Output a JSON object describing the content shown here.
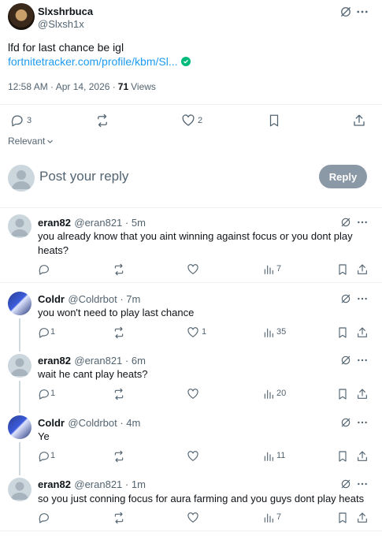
{
  "post": {
    "author_name": "Slxshrbuca",
    "author_handle": "@Slxsh1x",
    "text": "lfd for last chance be igl",
    "link_text": "fortnitetracker.com/profile/kbm/Sl...",
    "timestamp": "12:58 AM · Apr 14, 2026 ·",
    "views_count": "71",
    "views_label": "Views",
    "reply_count": "3",
    "like_count": "2",
    "sort_label": "Relevant"
  },
  "composer": {
    "placeholder": "Post your reply",
    "reply_button": "Reply"
  },
  "replies": [
    {
      "name": "eran82",
      "meta": "@eran821 · 5m",
      "text": "you already know that you aint winning against focus or you dont play heats?",
      "reply_count": "",
      "like_count": "",
      "views": "7"
    },
    {
      "name": "Coldr",
      "meta": "@Coldrbot · 7m",
      "text": "you won't need to play last chance",
      "reply_count": "1",
      "like_count": "1",
      "views": "35"
    },
    {
      "name": "eran82",
      "meta": "@eran821 · 6m",
      "text": "wait he cant play heats?",
      "reply_count": "1",
      "like_count": "",
      "views": "20"
    },
    {
      "name": "Coldr",
      "meta": "@Coldrbot · 4m",
      "text": "Ye",
      "reply_count": "1",
      "like_count": "",
      "views": "11"
    },
    {
      "name": "eran82",
      "meta": "@eran821 · 1m",
      "text": "so you just conning focus for aura farming and you guys dont play heats",
      "reply_count": "",
      "like_count": "",
      "views": "7"
    }
  ],
  "colors": {
    "link": "#1d9bf0",
    "text": "#0f1419",
    "muted": "#536471",
    "reply_button_bg": "#8b98a5",
    "verified": "#00ba7c"
  }
}
